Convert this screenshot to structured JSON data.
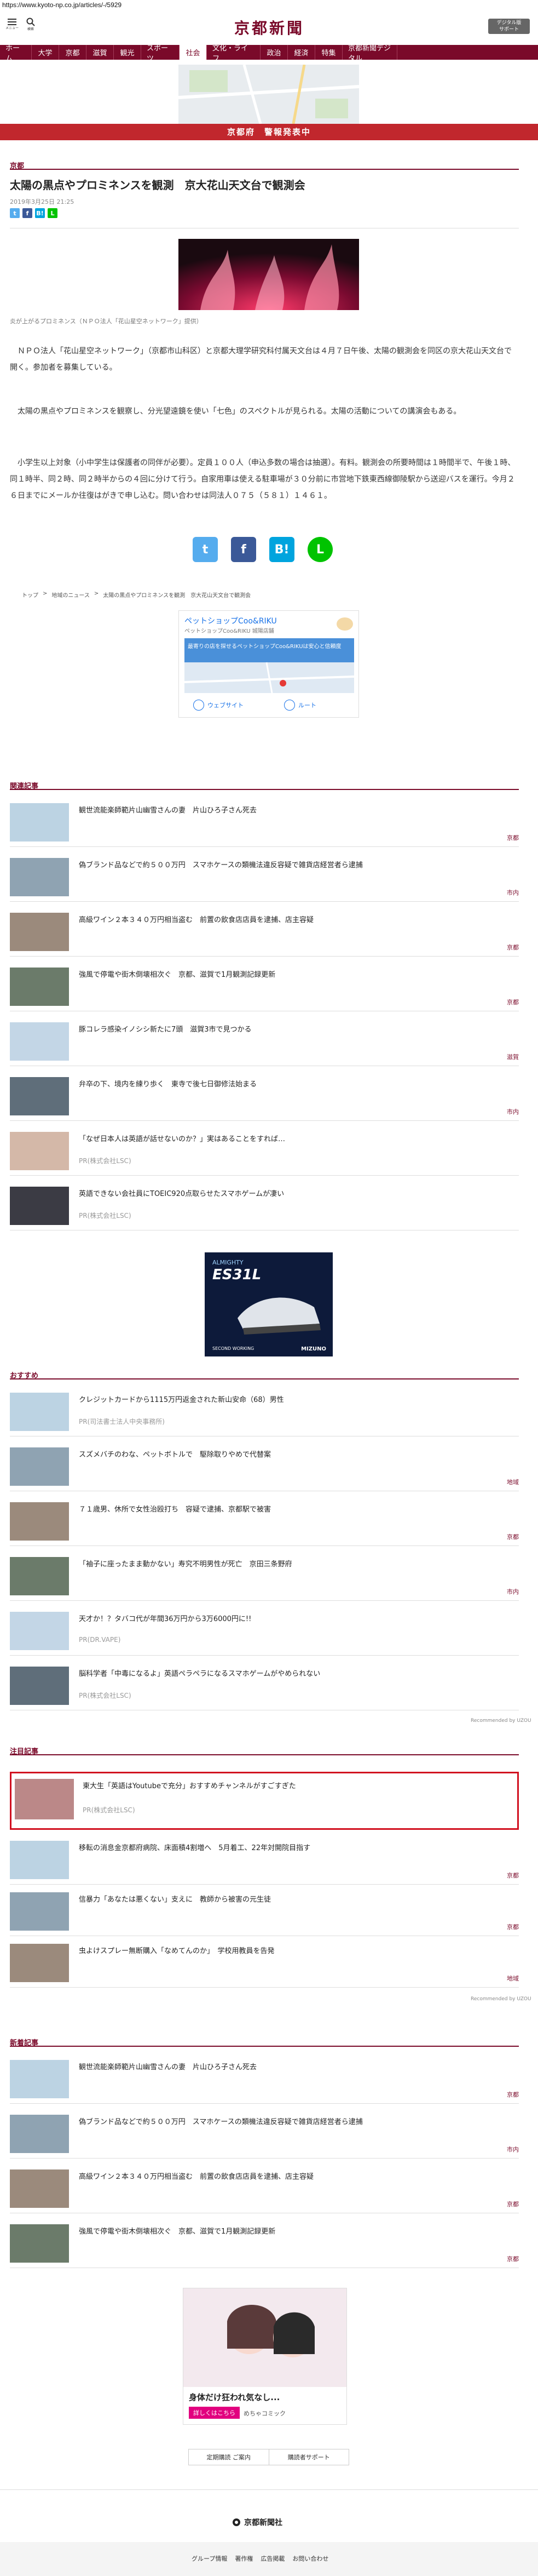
{
  "browser": {
    "url": "https://www.kyoto-np.co.jp/articles/-/5929"
  },
  "header": {
    "menu_label": "メニュー",
    "search_label": "検索",
    "logo": "京都新聞",
    "digital_line1": "デジタル版",
    "digital_line2": "サポート"
  },
  "nav": {
    "items": [
      "ホーム",
      "大学",
      "京都",
      "滋賀",
      "観光",
      "スポーツ",
      "社会",
      "文化・ライフ",
      "政治",
      "経済",
      "特集",
      "京都新聞デジタル"
    ],
    "active": "社会"
  },
  "alert_bar": {
    "text": "京都府　警報発表中"
  },
  "article": {
    "section": "京都",
    "title": "太陽の黒点やプロミネンスを観測　京大花山天文台で観測会",
    "date": "2019年3月25日 21:25",
    "photo_caption": "炎が上がるプロミネンス（ＮＰＯ法人「花山星空ネットワーク」提供）",
    "paragraphs": [
      "　ＮＰＯ法人「花山星空ネットワーク」（京都市山科区）と京都大理学研究科付属天文台は４月７日午後、太陽の観測会を同区の京大花山天文台で開く。参加者を募集している。",
      "　太陽の黒点やプロミネンスを観察し、分光望遠鏡を使い「七色」のスペクトルが見られる。太陽の活動についての講演会もある。",
      "　小学生以上対象（小中学生は保護者の同伴が必要）。定員１００人（申込多数の場合は抽選）。有料。観測会の所要時間は１時間半で、午後１時、同１時半、同２時、同２時半からの４回に分けて行う。自家用車は使える駐車場が３０分前に市営地下鉄東西線御陵駅から送迎バスを運行。今月２６日までにメールか往復はがきで申し込む。問い合わせは同法人０７５（５８１）１４６１。"
    ],
    "breadcrumb": [
      "トップ",
      "地域のニュース",
      "太陽の黒点やプロミネンスを観測　京大花山天文台で観測会"
    ],
    "share_small": [
      "t",
      "f",
      "B!",
      "L"
    ],
    "share_big": [
      "t",
      "f",
      "B!",
      "L"
    ]
  },
  "map_ad": {
    "title": "ペットショップCoo&RIKU",
    "subtitle": "ペットショップCoo&RIKU 城陽店舗",
    "banner": "最寄りの店を探せるペットショップCoo&RIKUは安心と信頼度",
    "website_btn": "ウェブサイト",
    "route_btn": "ルート"
  },
  "related": {
    "heading": "関連記事",
    "items": [
      {
        "title": "観世流能楽師範片山幽雪さんの妻　片山ひろ子さん死去",
        "tag": "京都"
      },
      {
        "title": "偽ブランド品などで約５００万円　スマホケースの類機法違反容疑で雑貨店経営者ら逮捕",
        "tag": "市内"
      },
      {
        "title": "高級ワイン２本３４０万円相当盗む　前置の飲食店店員を逮捕、店主容疑",
        "tag": "京都"
      },
      {
        "title": "強風で停電や街木倒壊相次ぐ　京都、滋賀で1月観測記録更新",
        "tag": "京都"
      },
      {
        "title": "豚コレラ感染イノシシ新たに7頭　滋賀3市で見つかる",
        "tag": "滋賀"
      },
      {
        "title": "弁卒の下、境内を練り歩く　東寺で後七日御修法始まる",
        "tag": "市内"
      },
      {
        "title": "「なぜ日本人は英語が話せないのか？」実はあることをすれば…",
        "tag": "",
        "pr": "PR(株式会社LSC)"
      },
      {
        "title": "英語できない会社員にTOEIC920点取らせたスマホゲームが凄い",
        "tag": "",
        "pr": "PR(株式会社LSC)"
      }
    ]
  },
  "shoe_ad": {
    "line1": "ALMIGHTY",
    "line2": "ES31L",
    "line3": "SECOND WORKING",
    "brand": "MIZUNO"
  },
  "recommend": {
    "heading": "おすすめ",
    "items": [
      {
        "title": "クレジットカードから1115万円返金された新山安命（68）男性",
        "tag": "",
        "pr": "PR(司法書士法人中央事務所)"
      },
      {
        "title": "スズメバチのわな、ペットボトルで　駆除取りやめで代替案",
        "tag": "地域"
      },
      {
        "title": "７１歳男、休所で女性治殴打ち　容疑で逮捕、京都駅で被害",
        "tag": "京都"
      },
      {
        "title": "「袖子に座ったまま動かない」寿究不明男性が死亡　京田三条野府",
        "tag": "市内"
      },
      {
        "title": "天才か！？タバコ代が年間36万円から3万6000円に!!",
        "tag": "",
        "pr": "PR(DR.VAPE)"
      },
      {
        "title": "脳科学者「中毒になるよ」英語ペラペラになるスマホゲームがやめられない",
        "tag": "",
        "pr": "PR(株式会社LSC)"
      }
    ],
    "credit": "Recommended by UZOU"
  },
  "attention": {
    "heading": "注目記事",
    "featured": {
      "title": "東大生「英語はYoutubeで充分」おすすめチャンネルがすごすぎた",
      "pr": "PR(株式会社LSC)"
    },
    "items": [
      {
        "title": "移転の消息金京都府病院、床面積4割増へ　5月着工、22年対開院目指す",
        "tag": "京都"
      },
      {
        "title": "信暴力「あなたは悪くない」支えに　教師から被害の元生徒",
        "tag": "京都"
      },
      {
        "title": "虫よけスプレー無断購入「なめてんのか」　学校用教員を告発",
        "tag": "地域"
      }
    ],
    "credit": "Recommended by UZOU"
  },
  "latest": {
    "heading": "新着記事",
    "items": [
      {
        "title": "観世流能楽師範片山幽雪さんの妻　片山ひろ子さん死去",
        "tag": "京都"
      },
      {
        "title": "偽ブランド品などで約５００万円　スマホケースの類機法違反容疑で雑貨店経営者ら逮捕",
        "tag": "市内"
      },
      {
        "title": "高級ワイン２本３４０万円相当盗む　前置の飲食店店員を逮捕、店主容疑",
        "tag": "京都"
      },
      {
        "title": "強風で停電や街木倒壊相次ぐ　京都、滋賀で1月観測記録更新",
        "tag": "京都"
      }
    ]
  },
  "manga_ad": {
    "text": "身体だけ狂われ気なし...",
    "btn": "詳しくはこちら",
    "brand": "めちゃコミック"
  },
  "footer": {
    "links_top": [
      "定期購読 ご案内",
      "購読者サポート"
    ],
    "company": "京都新聞社",
    "links_bottom": [
      "グループ情報",
      "著作権",
      "広告掲載",
      "お問い合わせ"
    ]
  },
  "colors": {
    "brand": "#7a0a2a",
    "alert": "#c1272d",
    "twitter": "#55acee",
    "facebook": "#3b5998",
    "hatena": "#00a4de",
    "line": "#00c300"
  }
}
